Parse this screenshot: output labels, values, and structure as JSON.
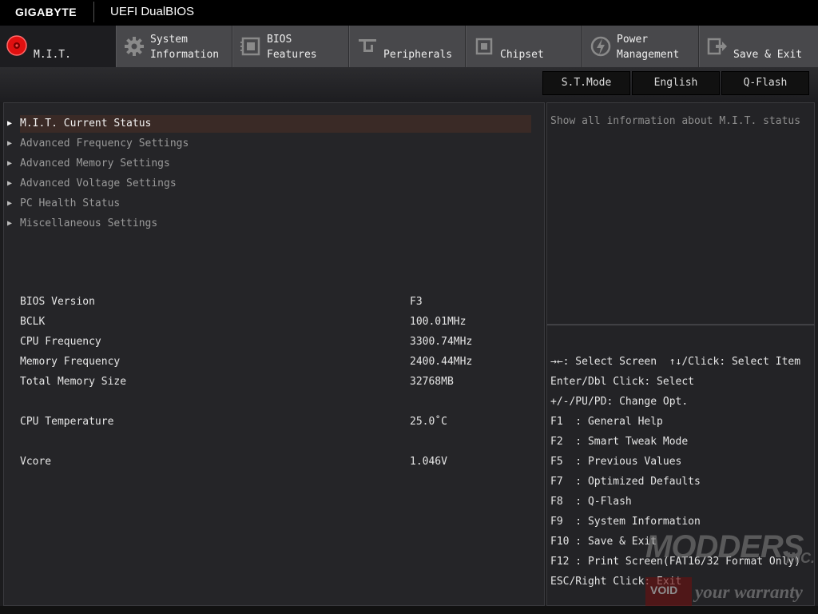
{
  "header": {
    "brand": "GIGABYTE",
    "product": "UEFI DualBIOS"
  },
  "tabs": [
    {
      "l1": "",
      "l2": "M.I.T.",
      "icon": "mit-icon",
      "active": true
    },
    {
      "l1": "System",
      "l2": "Information",
      "icon": "gear-icon"
    },
    {
      "l1": "BIOS",
      "l2": "Features",
      "icon": "bios-chip-icon"
    },
    {
      "l1": "",
      "l2": "Peripherals",
      "icon": "peripherals-icon"
    },
    {
      "l1": "",
      "l2": "Chipset",
      "icon": "chipset-icon"
    },
    {
      "l1": "Power",
      "l2": "Management",
      "icon": "power-icon"
    },
    {
      "l1": "",
      "l2": "Save & Exit",
      "icon": "exit-icon"
    }
  ],
  "subbar": {
    "st_mode": "S.T.Mode",
    "language": "English",
    "qflash": "Q-Flash"
  },
  "menu": [
    "M.I.T. Current Status",
    "Advanced Frequency Settings",
    "Advanced Memory Settings",
    "Advanced Voltage Settings",
    "PC Health Status",
    "Miscellaneous Settings"
  ],
  "info": {
    "bios_version": {
      "label": "BIOS Version",
      "value": "F3"
    },
    "bclk": {
      "label": "BCLK",
      "value": "100.01MHz"
    },
    "cpu_freq": {
      "label": "CPU Frequency",
      "value": "3300.74MHz"
    },
    "mem_freq": {
      "label": "Memory Frequency",
      "value": "2400.44MHz"
    },
    "mem_size": {
      "label": "Total Memory Size",
      "value": "32768MB"
    },
    "cpu_temp": {
      "label": "CPU Temperature",
      "value": "25.0˚C"
    },
    "vcore": {
      "label": "Vcore",
      "value": "1.046V"
    }
  },
  "help": {
    "text": "Show all information about M.I.T. status"
  },
  "keys": [
    "→←: Select Screen  ↑↓/Click: Select Item",
    "Enter/Dbl Click: Select",
    "+/-/PU/PD: Change Opt.",
    "F1  : General Help",
    "F2  : Smart Tweak Mode",
    "F5  : Previous Values",
    "F7  : Optimized Defaults",
    "F8  : Q-Flash",
    "F9  : System Information",
    "F10 : Save & Exit",
    "F12 : Print Screen(FAT16/32 Format Only)",
    "ESC/Right Click: Exit"
  ],
  "watermark": {
    "name": "MODDERS",
    "suffix": "INC.",
    "badge": "VOID",
    "tagline": "your warranty"
  },
  "colors": {
    "accent_red": "#e01010",
    "selected_row": "#3a2a26",
    "background": "#1c1c1e"
  }
}
